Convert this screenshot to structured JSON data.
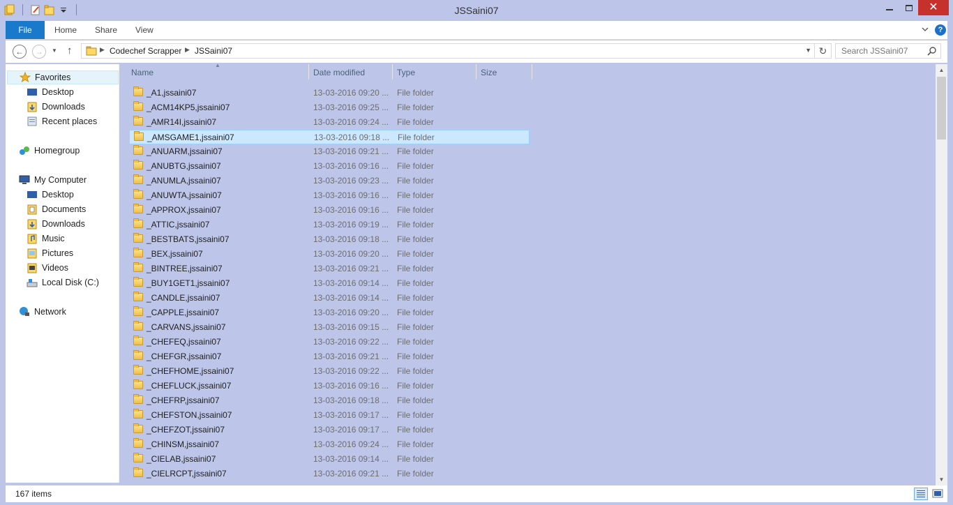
{
  "window": {
    "title": "JSSaini07"
  },
  "ribbon": {
    "tabs": [
      "File",
      "Home",
      "Share",
      "View"
    ],
    "help": "?"
  },
  "nav": {
    "breadcrumbs": [
      "Codechef Scrapper",
      "JSSaini07"
    ],
    "search_placeholder": "Search JSSaini07"
  },
  "navpane": {
    "favorites": "Favorites",
    "fav_items": [
      "Desktop",
      "Downloads",
      "Recent places"
    ],
    "homegroup": "Homegroup",
    "computer": "My Computer",
    "computer_items": [
      "Desktop",
      "Documents",
      "Downloads",
      "Music",
      "Pictures",
      "Videos",
      "Local Disk (C:)"
    ],
    "network": "Network"
  },
  "columns": {
    "name": "Name",
    "date": "Date modified",
    "type": "Type",
    "size": "Size"
  },
  "files": [
    {
      "name": "_A1,jssaini07",
      "date": "13-03-2016 09:20 ...",
      "type": "File folder"
    },
    {
      "name": "_ACM14KP5,jssaini07",
      "date": "13-03-2016 09:25 ...",
      "type": "File folder"
    },
    {
      "name": "_AMR14I,jssaini07",
      "date": "13-03-2016 09:24 ...",
      "type": "File folder"
    },
    {
      "name": "_AMSGAME1,jssaini07",
      "date": "13-03-2016 09:18 ...",
      "type": "File folder"
    },
    {
      "name": "_ANUARM,jssaini07",
      "date": "13-03-2016 09:21 ...",
      "type": "File folder"
    },
    {
      "name": "_ANUBTG,jssaini07",
      "date": "13-03-2016 09:16 ...",
      "type": "File folder"
    },
    {
      "name": "_ANUMLA,jssaini07",
      "date": "13-03-2016 09:23 ...",
      "type": "File folder"
    },
    {
      "name": "_ANUWTA,jssaini07",
      "date": "13-03-2016 09:16 ...",
      "type": "File folder"
    },
    {
      "name": "_APPROX,jssaini07",
      "date": "13-03-2016 09:16 ...",
      "type": "File folder"
    },
    {
      "name": "_ATTIC,jssaini07",
      "date": "13-03-2016 09:19 ...",
      "type": "File folder"
    },
    {
      "name": "_BESTBATS,jssaini07",
      "date": "13-03-2016 09:18 ...",
      "type": "File folder"
    },
    {
      "name": "_BEX,jssaini07",
      "date": "13-03-2016 09:20 ...",
      "type": "File folder"
    },
    {
      "name": "_BINTREE,jssaini07",
      "date": "13-03-2016 09:21 ...",
      "type": "File folder"
    },
    {
      "name": "_BUY1GET1,jssaini07",
      "date": "13-03-2016 09:14 ...",
      "type": "File folder"
    },
    {
      "name": "_CANDLE,jssaini07",
      "date": "13-03-2016 09:14 ...",
      "type": "File folder"
    },
    {
      "name": "_CAPPLE,jssaini07",
      "date": "13-03-2016 09:20 ...",
      "type": "File folder"
    },
    {
      "name": "_CARVANS,jssaini07",
      "date": "13-03-2016 09:15 ...",
      "type": "File folder"
    },
    {
      "name": "_CHEFEQ,jssaini07",
      "date": "13-03-2016 09:22 ...",
      "type": "File folder"
    },
    {
      "name": "_CHEFGR,jssaini07",
      "date": "13-03-2016 09:21 ...",
      "type": "File folder"
    },
    {
      "name": "_CHEFHOME,jssaini07",
      "date": "13-03-2016 09:22 ...",
      "type": "File folder"
    },
    {
      "name": "_CHEFLUCK,jssaini07",
      "date": "13-03-2016 09:16 ...",
      "type": "File folder"
    },
    {
      "name": "_CHEFRP,jssaini07",
      "date": "13-03-2016 09:18 ...",
      "type": "File folder"
    },
    {
      "name": "_CHEFSTON,jssaini07",
      "date": "13-03-2016 09:17 ...",
      "type": "File folder"
    },
    {
      "name": "_CHEFZOT,jssaini07",
      "date": "13-03-2016 09:17 ...",
      "type": "File folder"
    },
    {
      "name": "_CHINSM,jssaini07",
      "date": "13-03-2016 09:24 ...",
      "type": "File folder"
    },
    {
      "name": "_CIELAB,jssaini07",
      "date": "13-03-2016 09:14 ...",
      "type": "File folder"
    },
    {
      "name": "_CIELRCPT,jssaini07",
      "date": "13-03-2016 09:21 ...",
      "type": "File folder"
    }
  ],
  "selected_file": "_AMSGAME1,jssaini07",
  "status": {
    "count": "167 items"
  },
  "colors": {
    "file_tab": "#1979ca",
    "close_button": "#c7312b",
    "selection": "#cce8ff"
  }
}
